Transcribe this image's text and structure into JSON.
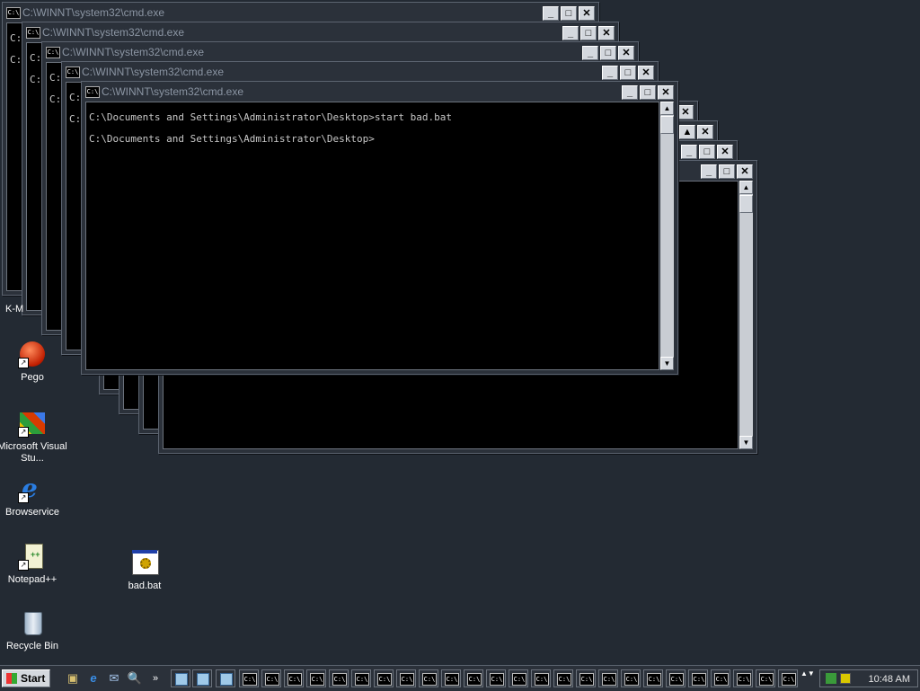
{
  "window_title": "C:\\WINNT\\system32\\cmd.exe",
  "console_icon_text": "C:\\",
  "console_lines": [
    "C:\\Documents and Settings\\Administrator\\Desktop>start bad.bat",
    "C:\\Documents and Settings\\Administrator\\Desktop>"
  ],
  "background_prompt_fragments": [
    "C:",
    "C:",
    "C:",
    "C:",
    "C:",
    "C:",
    "C:",
    "C:",
    "C:"
  ],
  "partial_icon_label": "K-M",
  "desktop_icons": [
    {
      "label": "Pego",
      "icon": "pego-icon"
    },
    {
      "label": "Microsoft Visual Stu...",
      "icon": "visual-studio-icon"
    },
    {
      "label": "Browservice",
      "icon": "internet-explorer-icon"
    },
    {
      "label": "Notepad++",
      "icon": "notepad-plus-plus-icon"
    },
    {
      "label": "Recycle Bin",
      "icon": "recycle-bin-icon"
    },
    {
      "label": "bad.bat",
      "icon": "batch-file-icon"
    }
  ],
  "taskbar": {
    "start_label": "Start",
    "clock": "10:48 AM",
    "overflow_label": "»",
    "quicklaunch": [
      "show-desktop-icon",
      "browser-icon",
      "outlook-icon",
      "explorer-icon"
    ]
  },
  "colors": {
    "desktop": "#232a33",
    "title_text": "#8b95a3",
    "console_bg": "#000000",
    "console_text": "#c8c8c8"
  }
}
